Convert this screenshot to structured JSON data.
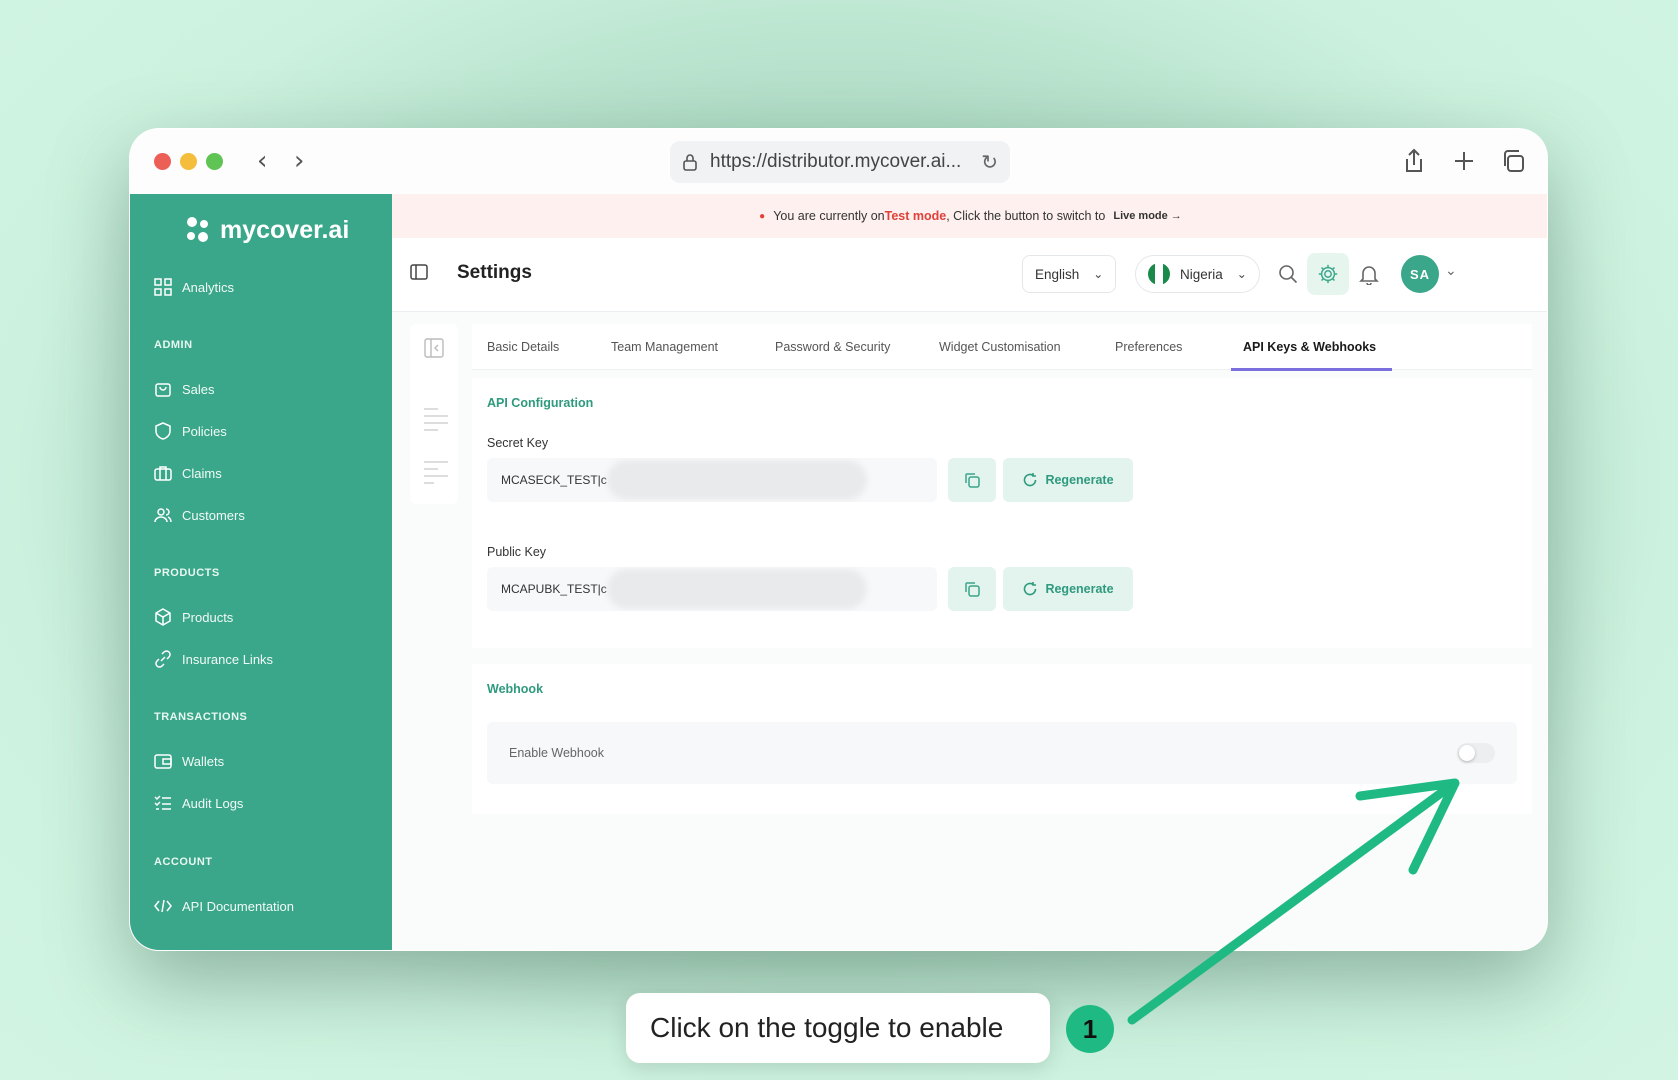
{
  "browser": {
    "url": "https://distributor.mycover.ai..."
  },
  "brand": {
    "name": "mycover.ai",
    "color": "#3aa68a"
  },
  "sidebar": {
    "items": [
      {
        "label": "Analytics"
      },
      {
        "label": "Sales"
      },
      {
        "label": "Policies"
      },
      {
        "label": "Claims"
      },
      {
        "label": "Customers"
      },
      {
        "label": "Products"
      },
      {
        "label": "Insurance Links"
      },
      {
        "label": "Wallets"
      },
      {
        "label": "Audit Logs"
      },
      {
        "label": "API Documentation"
      }
    ],
    "sections": {
      "admin": "ADMIN",
      "products": "PRODUCTS",
      "transactions": "TRANSACTIONS",
      "account": "ACCOUNT"
    }
  },
  "banner": {
    "prefix": "You are currently on ",
    "mode": "Test mode",
    "suffix": ", Click the button to switch to",
    "action": "Live mode →"
  },
  "header": {
    "title": "Settings",
    "language": "English",
    "country": "Nigeria",
    "avatar_initials": "SA"
  },
  "tabs": [
    {
      "label": "Basic Details"
    },
    {
      "label": "Team Management"
    },
    {
      "label": "Password & Security"
    },
    {
      "label": "Widget Customisation"
    },
    {
      "label": "Preferences"
    },
    {
      "label": "API Keys & Webhooks",
      "active": true
    }
  ],
  "api_config": {
    "title": "API Configuration",
    "secret_label": "Secret Key",
    "secret_value": "MCASECK_TEST|c",
    "public_label": "Public Key",
    "public_value": "MCAPUBK_TEST|c",
    "regenerate_label": "Regenerate"
  },
  "webhook": {
    "title": "Webhook",
    "enable_label": "Enable Webhook",
    "enabled": false
  },
  "tutorial": {
    "callout": "Click on the toggle to enable",
    "step": "1",
    "accent": "#1fba83"
  }
}
